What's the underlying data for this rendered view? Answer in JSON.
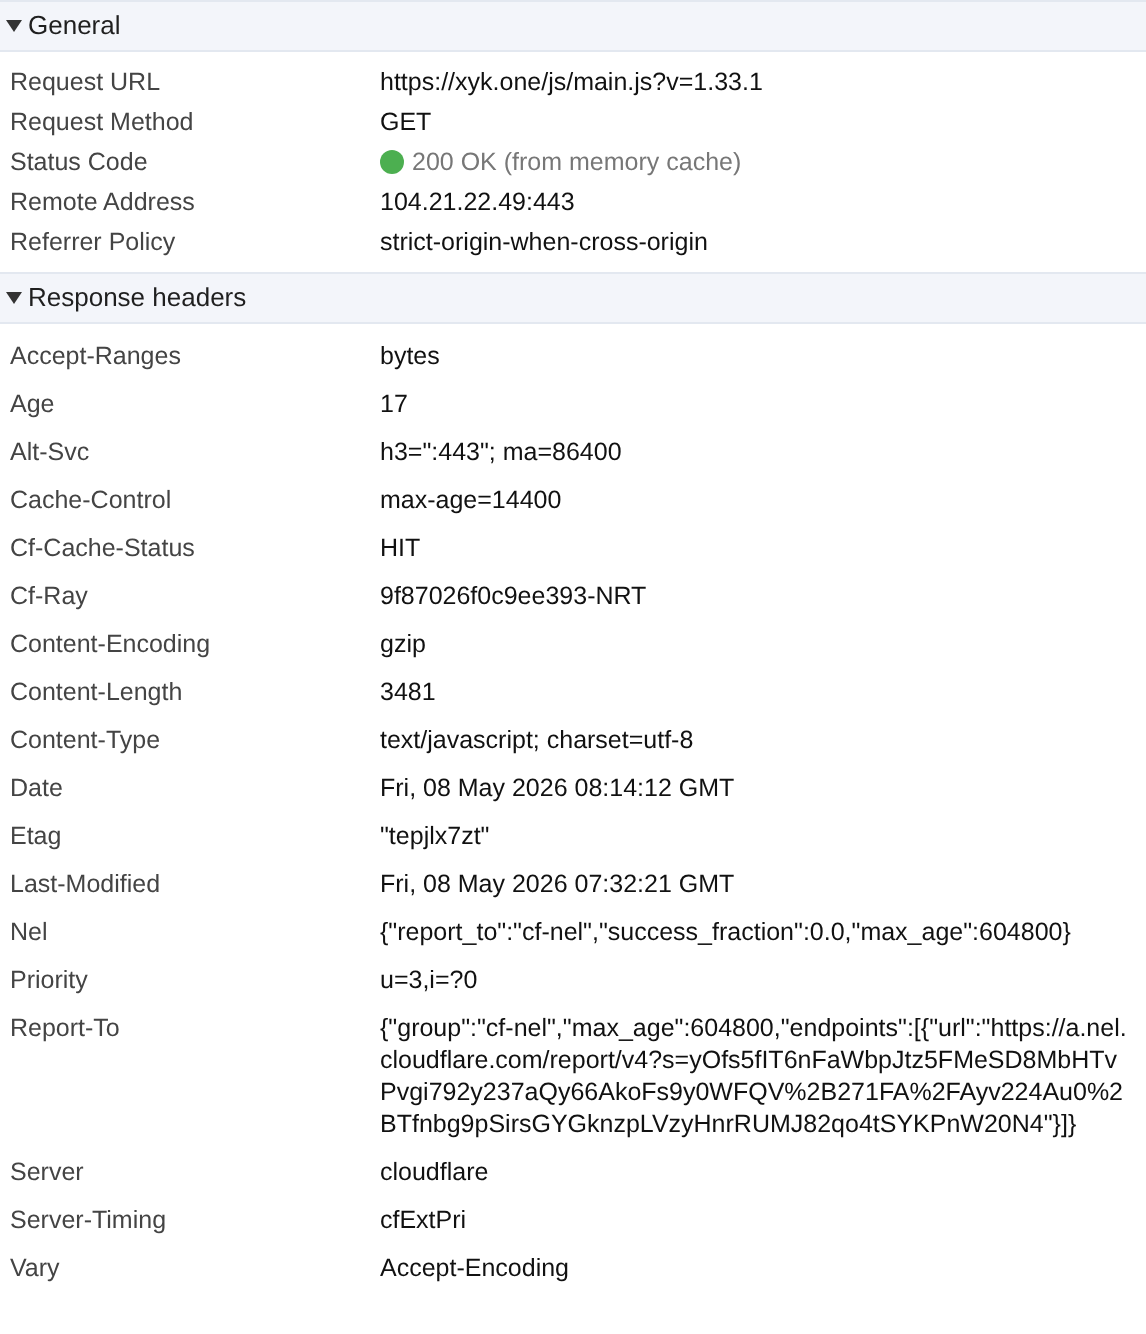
{
  "sections": [
    {
      "title": "General",
      "expanded": true,
      "rows": [
        {
          "name": "Request URL",
          "value": "https://xyk.one/js/main.js?v=1.33.1"
        },
        {
          "name": "Request Method",
          "value": "GET"
        },
        {
          "name": "Status Code",
          "value": "200 OK (from memory cache)",
          "kind": "status"
        },
        {
          "name": "Remote Address",
          "value": "104.21.22.49:443"
        },
        {
          "name": "Referrer Policy",
          "value": "strict-origin-when-cross-origin"
        }
      ]
    },
    {
      "title": "Response headers",
      "expanded": true,
      "rows": [
        {
          "name": "Accept-Ranges",
          "value": "bytes"
        },
        {
          "name": "Age",
          "value": "17"
        },
        {
          "name": "Alt-Svc",
          "value": "h3=\":443\"; ma=86400"
        },
        {
          "name": "Cache-Control",
          "value": "max-age=14400"
        },
        {
          "name": "Cf-Cache-Status",
          "value": "HIT"
        },
        {
          "name": "Cf-Ray",
          "value": "9f87026f0c9ee393-NRT"
        },
        {
          "name": "Content-Encoding",
          "value": "gzip"
        },
        {
          "name": "Content-Length",
          "value": "3481"
        },
        {
          "name": "Content-Type",
          "value": "text/javascript; charset=utf-8"
        },
        {
          "name": "Date",
          "value": "Fri, 08 May 2026 08:14:12 GMT"
        },
        {
          "name": "Etag",
          "value": "\"tepjlx7zt\""
        },
        {
          "name": "Last-Modified",
          "value": "Fri, 08 May 2026 07:32:21 GMT"
        },
        {
          "name": "Nel",
          "value": "{\"report_to\":\"cf-nel\",\"success_fraction\":0.0,\"max_age\":604800}"
        },
        {
          "name": "Priority",
          "value": "u=3,i=?0"
        },
        {
          "name": "Report-To",
          "value": "{\"group\":\"cf-nel\",\"max_age\":604800,\"endpoints\":[{\"url\":\"https://a.nel.cloudflare.com/report/v4?s=yOfs5fIT6nFaWbpJtz5FMeSD8MbHTvPvgi792y237aQy66AkoFs9y0WFQV%2B271FA%2FAyv224Au0%2BTfnbg9pSirsGYGknzpLVzyHnrRUMJ82qo4tSYKPnW20N4\"}]}"
        },
        {
          "name": "Server",
          "value": "cloudflare"
        },
        {
          "name": "Server-Timing",
          "value": "cfExtPri"
        },
        {
          "name": "Vary",
          "value": "Accept-Encoding"
        }
      ]
    }
  ]
}
